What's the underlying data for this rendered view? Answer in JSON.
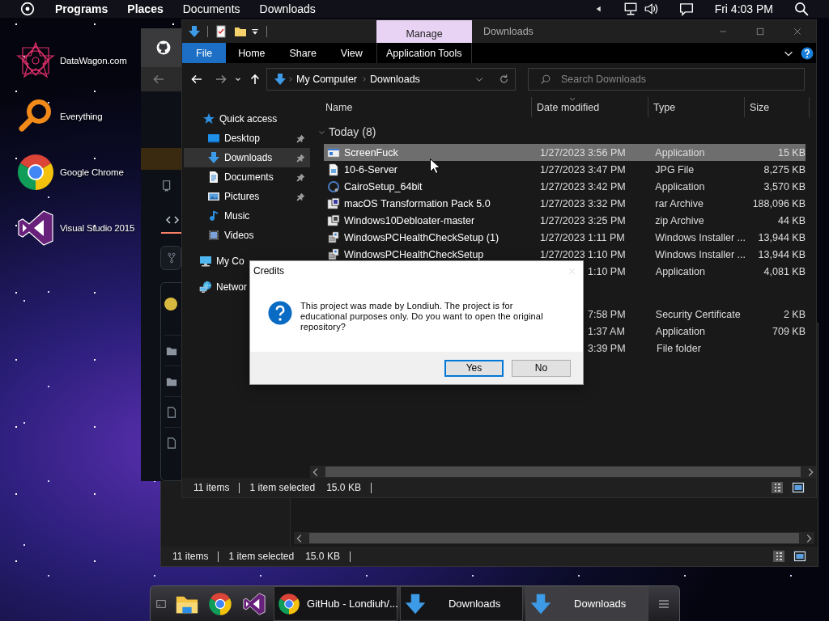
{
  "top_bar": {
    "menus": [
      {
        "label": "Programs",
        "bold": true
      },
      {
        "label": "Places",
        "bold": true
      },
      {
        "label": "Documents",
        "bold": false
      },
      {
        "label": "Downloads",
        "bold": false
      }
    ],
    "clock": "Fri 4:03 PM"
  },
  "desktop_icons": [
    {
      "label": "DataWagon.com",
      "kind": "mandala"
    },
    {
      "label": "Everything",
      "kind": "magnifier"
    },
    {
      "label": "Google Chrome",
      "kind": "chrome"
    },
    {
      "label": "Visual Studio 2015",
      "kind": "studio"
    }
  ],
  "back_explorer": {
    "status": [
      "11 items",
      "1 item selected",
      "15.0 KB"
    ]
  },
  "explorer": {
    "contextual_tab": "Manage",
    "title": "Downloads",
    "ribbon_tabs": [
      {
        "label": "File",
        "selected": true,
        "contextual": false
      },
      {
        "label": "Home",
        "selected": false,
        "contextual": false
      },
      {
        "label": "Share",
        "selected": false,
        "contextual": false
      },
      {
        "label": "View",
        "selected": false,
        "contextual": false
      },
      {
        "label": "Application Tools",
        "selected": false,
        "contextual": true
      }
    ],
    "breadcrumb": [
      "My Computer",
      "Downloads"
    ],
    "search": {
      "placeholder": "Search Downloads"
    },
    "sidebar": [
      {
        "label": "Quick access",
        "kind": "star",
        "selected": false,
        "children": [
          {
            "label": "Desktop",
            "kind": "desktop",
            "pinned": true,
            "selected": false
          },
          {
            "label": "Downloads",
            "kind": "downloads",
            "pinned": true,
            "selected": true
          },
          {
            "label": "Documents",
            "kind": "documents",
            "pinned": true,
            "selected": false
          },
          {
            "label": "Pictures",
            "kind": "pictures",
            "pinned": true,
            "selected": false
          },
          {
            "label": "Music",
            "kind": "music",
            "pinned": false,
            "selected": false
          },
          {
            "label": "Videos",
            "kind": "videos",
            "pinned": false,
            "selected": false
          }
        ]
      },
      {
        "label": "My Co",
        "kind": "computer",
        "selected": false
      },
      {
        "label": "Networ",
        "kind": "network",
        "selected": false
      }
    ],
    "columns": [
      {
        "label": "Name",
        "sorted": false
      },
      {
        "label": "Date modified",
        "sorted": true
      },
      {
        "label": "Type",
        "sorted": false
      },
      {
        "label": "Size",
        "sorted": false
      }
    ],
    "groups": [
      {
        "label": "Today (8)",
        "rows": [
          {
            "name": "ScreenFuck",
            "kind": "app",
            "date": "1/27/2023 3:56 PM",
            "type": "Application",
            "size": "15 KB",
            "selected": true
          },
          {
            "name": "10-6-Server",
            "kind": "jpg",
            "date": "1/27/2023 3:47 PM",
            "type": "JPG File",
            "size": "8,275 KB",
            "selected": false
          },
          {
            "name": "CairoSetup_64bit",
            "kind": "cairo",
            "date": "1/27/2023 3:42 PM",
            "type": "Application",
            "size": "3,570 KB",
            "selected": false
          },
          {
            "name": "macOS Transformation Pack 5.0",
            "kind": "rar",
            "date": "1/27/2023 3:32 PM",
            "type": "rar Archive",
            "size": "188,096 KB",
            "selected": false
          },
          {
            "name": "Windows10Debloater-master",
            "kind": "zip",
            "date": "1/27/2023 3:25 PM",
            "type": "zip Archive",
            "size": "44 KB",
            "selected": false
          },
          {
            "name": "WindowsPCHealthCheckSetup (1)",
            "kind": "installer",
            "date": "1/27/2023 1:11 PM",
            "type": "Windows Installer ...",
            "size": "13,944 KB",
            "selected": false
          },
          {
            "name": "WindowsPCHealthCheckSetup",
            "kind": "installer",
            "date": "1/27/2023 1:10 PM",
            "type": "Windows Installer ...",
            "size": "13,944 KB",
            "selected": false
          },
          {
            "date": "1:10 PM",
            "type": "Application",
            "size": "4,081 KB",
            "selected": false
          }
        ]
      },
      {
        "rows": [
          {
            "date": "7:58 PM",
            "type": "Security Certificate",
            "size": "2 KB",
            "selected": false
          },
          {
            "date": "1:37 AM",
            "type": "Application",
            "size": "709 KB",
            "selected": false
          },
          {
            "date": "3:39 PM",
            "type": "File folder",
            "selected": false
          }
        ]
      }
    ],
    "status": [
      "11 items",
      "1 item selected",
      "15.0 KB"
    ]
  },
  "dialog": {
    "title": "Credits",
    "message": "This project was made by Londiuh. The project is for educational purposes only. Do you want to open the original repository?",
    "buttons": [
      {
        "label": "Yes",
        "selected": true
      },
      {
        "label": "No",
        "selected": false
      }
    ]
  },
  "taskbar": {
    "launchers": [
      {
        "kind": "console"
      },
      {
        "kind": "explorer"
      },
      {
        "kind": "chrome"
      },
      {
        "kind": "studio"
      }
    ],
    "tasks": [
      {
        "label": "GitHub - Londiuh/...",
        "kind": "chrome",
        "selected": false
      },
      {
        "label": "Downloads",
        "kind": "download",
        "selected": false
      },
      {
        "label": "Downloads",
        "kind": "download",
        "selected": true
      }
    ]
  }
}
